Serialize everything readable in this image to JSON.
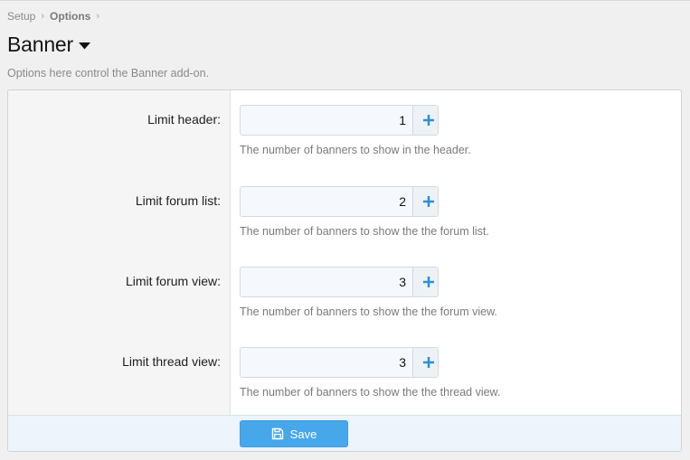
{
  "breadcrumb": [
    {
      "label": "Setup"
    },
    {
      "label": "Options"
    }
  ],
  "page": {
    "title": "Banner",
    "description": "Options here control the Banner add-on."
  },
  "options": [
    {
      "label": "Limit header:",
      "value": "1",
      "hint": "The number of banners to show in the header."
    },
    {
      "label": "Limit forum list:",
      "value": "2",
      "hint": "The number of banners to show the the forum list."
    },
    {
      "label": "Limit forum view:",
      "value": "3",
      "hint": "The number of banners to show the the forum view."
    },
    {
      "label": "Limit thread view:",
      "value": "3",
      "hint": "The number of banners to show the the thread view."
    }
  ],
  "footer": {
    "save_label": "Save"
  },
  "icons": {
    "plus": "plus-icon",
    "minus": "minus-icon",
    "save": "save-icon",
    "caret": "caret-down-icon"
  },
  "colors": {
    "accent": "#47a7eb",
    "stepper_icon": "#2f8fd8"
  }
}
